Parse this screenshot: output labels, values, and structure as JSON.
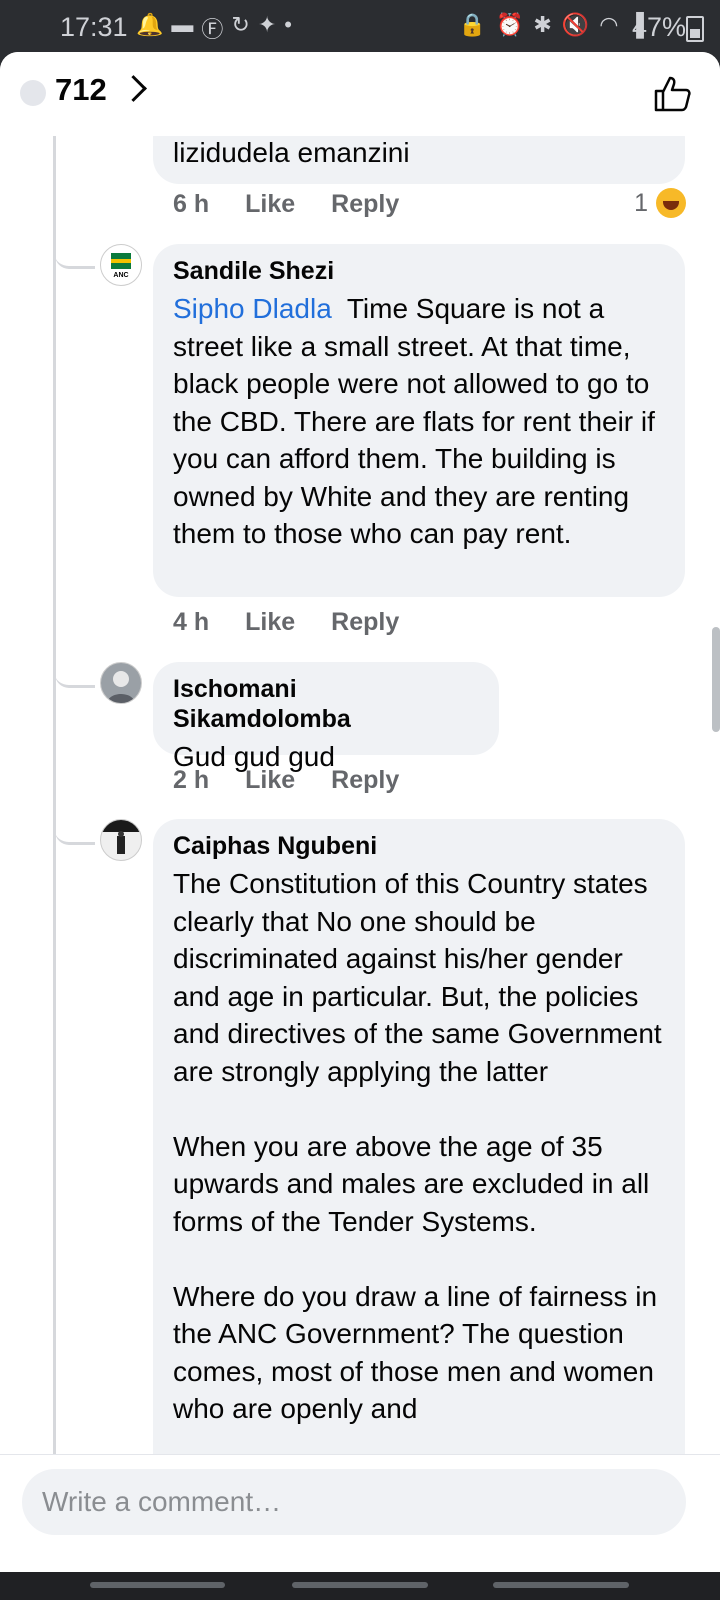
{
  "status_bar": {
    "time": "17:31",
    "left_icons": [
      "notification-icon",
      "message-icon",
      "facebook-icon",
      "sync-icon",
      "twitter-icon",
      "dot-icon"
    ],
    "right_icons": [
      "lock-icon",
      "alarm-icon",
      "bluetooth-icon",
      "mute-icon",
      "wifi-icon",
      "signal-icon"
    ],
    "battery": "47%"
  },
  "header": {
    "reaction_count": "712"
  },
  "comments": [
    {
      "text": "lizidudela emanzini",
      "time": "6 h",
      "like": "Like",
      "reply": "Reply",
      "reaction_count": "1",
      "reaction": "laugh-emoji"
    },
    {
      "author": "Sandile Shezi",
      "avatar_text": "ANC",
      "mention": "Sipho Dladla",
      "text": "Time Square is not a street like a small street. At that time, black people were not allowed to go to the CBD. There are flats for rent their if you can afford them. The building is owned by White and they are renting them to those who can pay rent.",
      "time": "4 h",
      "like": "Like",
      "reply": "Reply"
    },
    {
      "author": "Ischomani Sikamdolomba",
      "text": "Gud gud gud",
      "time": "2 h",
      "like": "Like",
      "reply": "Reply"
    },
    {
      "author": "Caiphas Ngubeni",
      "text": "The Constitution of this Country states clearly that No one should be discriminated against his/her gender and age in particular. But, the policies and directives of the same Government are strongly applying the latter\n\nWhen you are above the age of 35 upwards and males are excluded in all forms of the Tender Systems.\n\nWhere do you draw a line of fairness in the ANC Government? The question comes, most of those men and women who are openly and"
    }
  ],
  "composer": {
    "placeholder": "Write a comment…"
  },
  "colors": {
    "mention": "#216fdb",
    "bubble": "#f0f2f5",
    "meta": "#65676b"
  }
}
